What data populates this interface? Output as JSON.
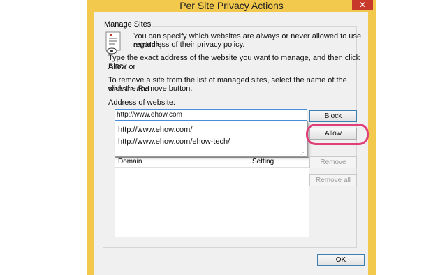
{
  "window": {
    "title": "Per Site Privacy Actions",
    "close_label": "✕"
  },
  "group": {
    "label": "Manage Sites",
    "intro_line1": "You can specify which websites are always or never allowed to use cookies,",
    "intro_line2": "regardless of their privacy policy.",
    "instr1_line1": "Type the exact address of the website you want to manage, and then click Allow or",
    "instr1_line2": "Block.",
    "instr2_line1": "To remove a site from the list of managed sites, select the name of the website and",
    "instr2_line2": "click the Remove button.",
    "address_label": "Address of website:"
  },
  "address_input": {
    "value": "http://www.ehow.com"
  },
  "suggestions": [
    "http://www.ehow.com/",
    "http://www.ehow.com/ehow-tech/"
  ],
  "list": {
    "col_domain": "Domain",
    "col_setting": "Setting"
  },
  "buttons": {
    "block": "Block",
    "allow": "Allow",
    "remove": "Remove",
    "remove_all": "Remove all",
    "ok": "OK"
  },
  "colors": {
    "title_bar": "#f2c94c",
    "close": "#c7392b",
    "highlight": "#e0407a"
  }
}
